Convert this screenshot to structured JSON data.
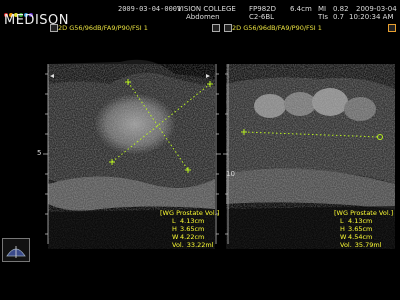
{
  "brand": "MEDISON",
  "header": {
    "date": "2009-03-04-0001",
    "institution": "VISION COLLEGE",
    "application": "Abdomen",
    "preset": "FP982D",
    "probe": "C2-6BL",
    "depth": "6.4cm",
    "mi_label": "MI",
    "mi_value": "0.82",
    "tis_label": "TIs",
    "tis_value": "0.7",
    "date2": "2009-03-04",
    "time": "10:20:34 AM"
  },
  "left_panel": {
    "params": "2D G56/96dB/FA9/P90/FSI 1",
    "measurement": {
      "title": "[WG Prostate Vol.]",
      "L_label": "L",
      "L": "4.13cm",
      "H_label": "H",
      "H": "3.65cm",
      "W_label": "W",
      "W": "4.22cm",
      "vol_label": "Vol.",
      "vol": "33.22ml"
    }
  },
  "right_panel": {
    "params": "2D G56/96dB/FA9/P90/FSI 1",
    "measurement": {
      "title": "[WG Prostate Vol.]",
      "L_label": "L",
      "L": "4.13cm",
      "H_label": "H",
      "H": "3.65cm",
      "W_label": "W",
      "W": "4.54cm",
      "vol_label": "Vol.",
      "vol": "35.79ml"
    }
  },
  "depth_marks": [
    "5",
    "10"
  ],
  "colors": {
    "measurement": "#ffff33",
    "caliper": "#b8f020",
    "header_text": "#dddddd"
  }
}
